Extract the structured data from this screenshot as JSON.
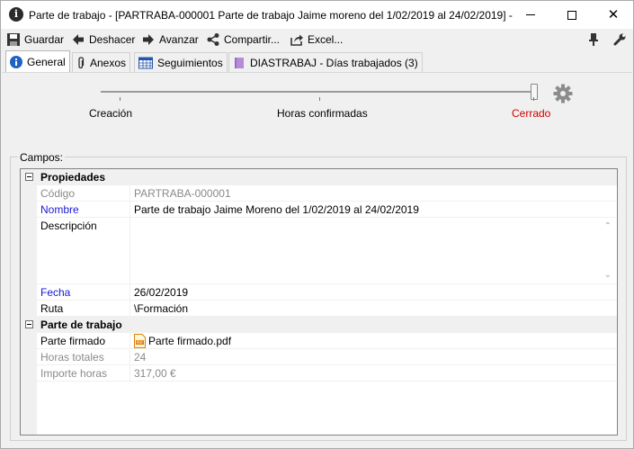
{
  "window": {
    "title": "Parte de trabajo - [PARTRABA-000001 Parte de trabajo Jaime moreno del 1/02/2019 al 24/02/2019] - ...",
    "title_icon": "info-icon",
    "controls": [
      "minimize-icon",
      "maximize-icon",
      "close-icon"
    ]
  },
  "toolbar": {
    "save_label": "Guardar",
    "undo_label": "Deshacer",
    "forward_label": "Avanzar",
    "share_label": "Compartir...",
    "excel_label": "Excel...",
    "pin_icon": "pin-icon",
    "tools_icon": "wrench-icon"
  },
  "tabs": [
    {
      "label": "General",
      "icon": "info-icon",
      "active": true
    },
    {
      "label": "Anexos",
      "icon": "paperclip-icon",
      "active": false
    },
    {
      "label": "Seguimientos",
      "icon": "calendar-icon",
      "active": false
    },
    {
      "label": "DIASTRABAJ - Días trabajados (3)",
      "icon": "folder-icon",
      "active": false
    }
  ],
  "workflow": {
    "steps": [
      "Creación",
      "Horas confirmadas",
      "Cerrado"
    ],
    "current": "Cerrado",
    "current_color": "#d40000",
    "settings_icon": "gear-icon"
  },
  "campos": {
    "label": "Campos:",
    "categories": [
      {
        "label": "Propiedades"
      },
      {
        "label": "Parte de trabajo"
      }
    ],
    "rows": {
      "codigo": {
        "name": "Código",
        "value": "PARTRABA-000001"
      },
      "nombre": {
        "name": "Nombre",
        "value": "Parte de trabajo Jaime Moreno del 1/02/2019 al 24/02/2019"
      },
      "descripcion": {
        "name": "Descripción",
        "value": ""
      },
      "fecha": {
        "name": "Fecha",
        "value": "26/02/2019"
      },
      "ruta": {
        "name": "Ruta",
        "value": "\\Formación"
      },
      "parte_firmado": {
        "name": "Parte firmado",
        "value": "Parte firmado.pdf",
        "icon": "pdf-file-icon"
      },
      "horas_totales": {
        "name": "Horas totales",
        "value": "24"
      },
      "importe_horas": {
        "name": "Importe horas",
        "value": "317,00 €"
      }
    },
    "colors": {
      "readonly": "#8a8a8a",
      "required": "#1a1ad6"
    }
  }
}
